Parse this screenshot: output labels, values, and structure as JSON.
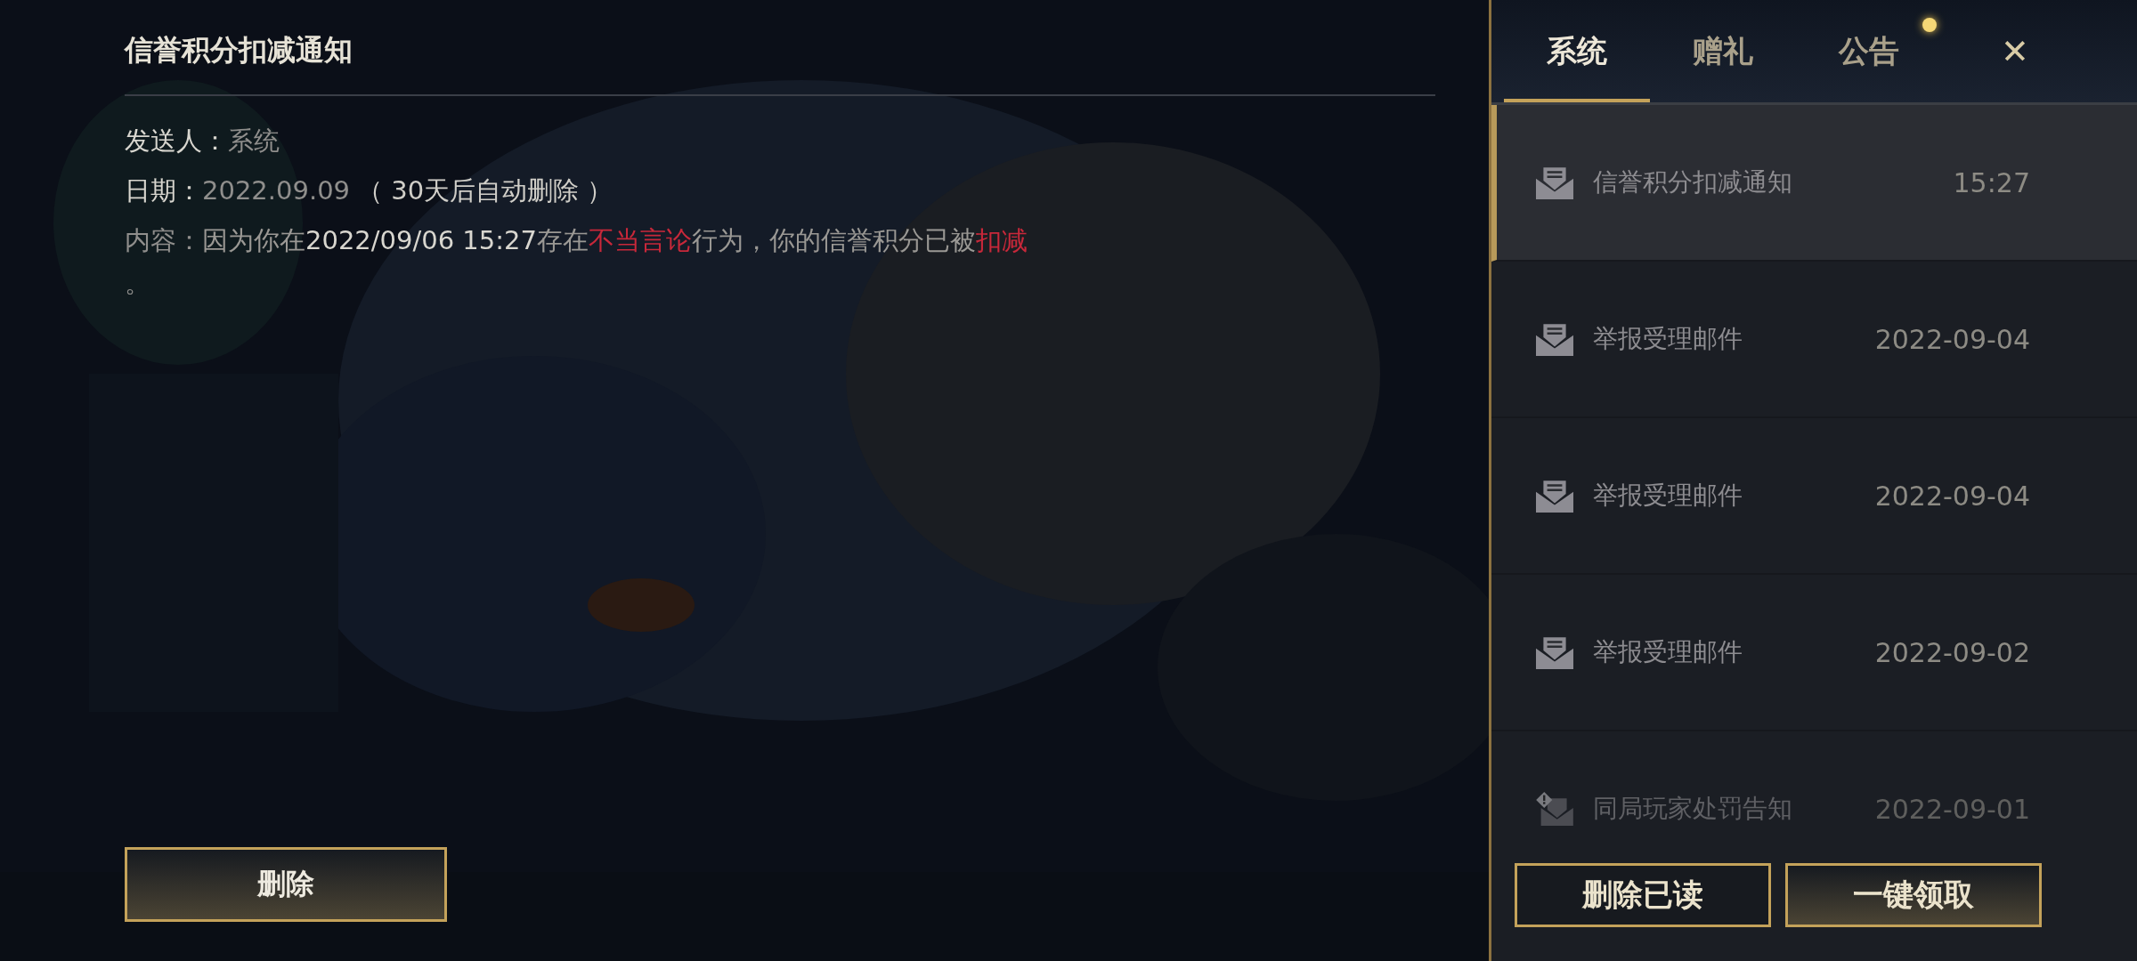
{
  "mail": {
    "title": "信誉积分扣减通知",
    "sender_label": "发送人：",
    "sender": "系统",
    "date_label": "日期：",
    "date": "2022.09.09",
    "date_note": "（ 30天后自动删除 ）",
    "content_label": "内容：",
    "content": [
      {
        "text": "因为你在",
        "kind": "normal"
      },
      {
        "text": "2022/09/06 15:27",
        "kind": "strong"
      },
      {
        "text": "存在",
        "kind": "normal"
      },
      {
        "text": "不当言论",
        "kind": "highlight"
      },
      {
        "text": "行为，你的信誉积分已被",
        "kind": "normal"
      },
      {
        "text": "扣减",
        "kind": "highlight"
      }
    ],
    "content_end": "。",
    "delete_button": "删除"
  },
  "tabs": [
    {
      "label": "系统",
      "selected": true,
      "badge": false
    },
    {
      "label": "赠礼",
      "selected": false,
      "badge": false
    },
    {
      "label": "公告",
      "selected": false,
      "badge": true
    }
  ],
  "close": "✕",
  "mails": [
    {
      "subject": "信誉积分扣减通知",
      "time": "15:27",
      "selected": true,
      "kind": "mail"
    },
    {
      "subject": "举报受理邮件",
      "time": "2022-09-04",
      "selected": false,
      "kind": "mail"
    },
    {
      "subject": "举报受理邮件",
      "time": "2022-09-04",
      "selected": false,
      "kind": "mail"
    },
    {
      "subject": "举报受理邮件",
      "time": "2022-09-02",
      "selected": false,
      "kind": "mail"
    },
    {
      "subject": "同局玩家处罚告知",
      "time": "2022-09-01",
      "selected": false,
      "kind": "warning"
    }
  ],
  "buttons": [
    "删除已读",
    "一键领取"
  ]
}
